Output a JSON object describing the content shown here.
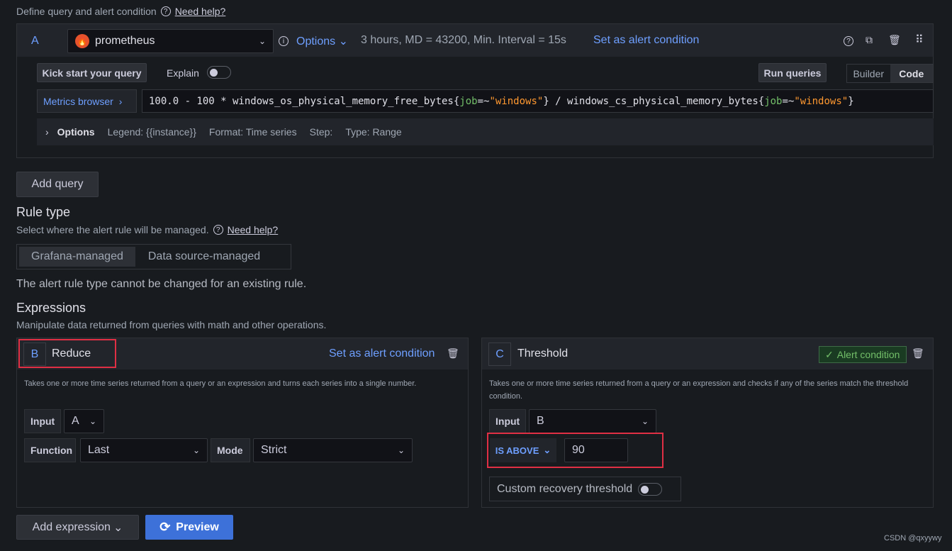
{
  "header": {
    "title": "Define query and alert condition",
    "help": "Need help?"
  },
  "query": {
    "ref": "A",
    "datasource": "prometheus",
    "options_label": "Options",
    "options_summary": "3 hours, MD = 43200, Min. Interval = 15s",
    "set_alert": "Set as alert condition",
    "kick_start": "Kick start your query",
    "explain": "Explain",
    "run_queries": "Run queries",
    "builder": "Builder",
    "code": "Code",
    "metrics_browser": "Metrics browser",
    "expr": {
      "p1": "100.0 - 100 * windows_os_physical_memory_free_bytes{",
      "k1": "job",
      "op1": "=~",
      "v1": "\"windows\"",
      "p2": "} / windows_cs_physical_memory_bytes{",
      "k2": "job",
      "op2": "=~",
      "v2": "\"windows\"",
      "p3": "}"
    },
    "opts": {
      "label": "Options",
      "legend": "Legend: {{instance}}",
      "format": "Format: Time series",
      "step": "Step:",
      "type": "Type: Range"
    }
  },
  "add_query": "Add query",
  "rule_type": {
    "title": "Rule type",
    "desc": "Select where the alert rule will be managed.",
    "help": "Need help?",
    "grafana": "Grafana-managed",
    "datasource": "Data source-managed",
    "note": "The alert rule type cannot be changed for an existing rule."
  },
  "expressions": {
    "title": "Expressions",
    "desc": "Manipulate data returned from queries with math and other operations.",
    "reduce": {
      "ref": "B",
      "name": "Reduce",
      "set_alert": "Set as alert condition",
      "desc": "Takes one or more time series returned from a query or an expression and turns each series into a single number.",
      "input_label": "Input",
      "input_value": "A",
      "function_label": "Function",
      "function_value": "Last",
      "mode_label": "Mode",
      "mode_value": "Strict"
    },
    "threshold": {
      "ref": "C",
      "name": "Threshold",
      "badge": "Alert condition",
      "desc": "Takes one or more time series returned from a query or an expression and checks if any of the series match the threshold condition.",
      "input_label": "Input",
      "input_value": "B",
      "op": "IS ABOVE",
      "value": "90",
      "recovery": "Custom recovery threshold"
    }
  },
  "add_expression": "Add expression",
  "preview": "Preview",
  "watermark": "CSDN @qxyywy"
}
